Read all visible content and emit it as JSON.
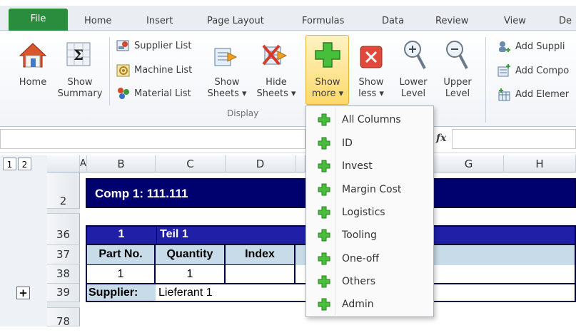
{
  "tabs": {
    "file": "File",
    "items": [
      "Home",
      "Insert",
      "Page Layout",
      "Formulas",
      "Data",
      "Review",
      "View",
      "De"
    ]
  },
  "ribbon": {
    "home_label": "Home",
    "show_summary_label": [
      "Show",
      "Summary"
    ],
    "supplier_list": "Supplier List",
    "machine_list": "Machine List",
    "material_list": "Material List",
    "show_sheets": [
      "Show",
      "Sheets ▾"
    ],
    "hide_sheets": [
      "Hide",
      "Sheets ▾"
    ],
    "show_more": [
      "Show",
      "more ▾"
    ],
    "show_less": [
      "Show",
      "less ▾"
    ],
    "lower_level": [
      "Lower",
      "Level"
    ],
    "upper_level": [
      "Upper",
      "Level"
    ],
    "display_group": "Display",
    "add_supplier": "Add Suppli",
    "add_component": "Add Compo",
    "add_element": "Add Elemer"
  },
  "formula_bar": {
    "fx": "fx"
  },
  "outline_levels": [
    "1",
    "2"
  ],
  "columns": [
    "A",
    "B",
    "C",
    "D",
    "G",
    "H"
  ],
  "rows": {
    "r2": "2",
    "r36": "36",
    "r37": "37",
    "r38": "38",
    "r39": "39",
    "r78": "78"
  },
  "sheet": {
    "comp_title": "Comp 1: 111.111",
    "teil_num": "1",
    "teil_name": "Teil 1",
    "hdr_part": "Part No.",
    "hdr_qty": "Quantity",
    "hdr_index": "Index",
    "val_part": "1",
    "val_qty": "1",
    "supplier_label": "Supplier:",
    "supplier_value": "Lieferant 1",
    "expand_button": "+"
  },
  "menu": {
    "items": [
      "All Columns",
      "ID",
      "Invest",
      "Margin Cost",
      "Logistics",
      "Tooling",
      "One-off",
      "Others",
      "Admin"
    ]
  },
  "colors": {
    "file_tab": "#2a8d3e",
    "comp_band": "#00006f",
    "teil_band": "#1f1fa8",
    "header_band": "#c8dbe8",
    "plus_green": "#3db83a"
  }
}
